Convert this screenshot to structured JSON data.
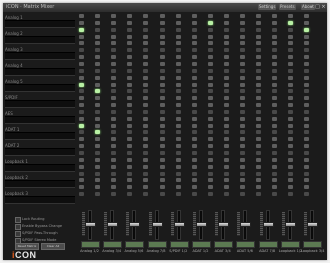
{
  "window": {
    "title": "iCON · Matrix Mixer"
  },
  "titlebar": {
    "buttons": [
      "Settings",
      "Presets",
      "About"
    ]
  },
  "rows": [
    {
      "name": "Analog 1"
    },
    {
      "name": "Analog 2"
    },
    {
      "name": "Analog 3"
    },
    {
      "name": "Analog 4"
    },
    {
      "name": "Analog 5"
    },
    {
      "name": "S/PDIF"
    },
    {
      "name": "AES"
    },
    {
      "name": "ADAT 1"
    },
    {
      "name": "ADAT 2"
    },
    {
      "name": "Loopback 1"
    },
    {
      "name": "Loopback 2"
    },
    {
      "name": "Loopback 3"
    }
  ],
  "matrix": {
    "rows": 27,
    "cols": 15,
    "active": [
      [
        1,
        8
      ],
      [
        1,
        13
      ],
      [
        2,
        0
      ],
      [
        2,
        14
      ],
      [
        10,
        0
      ],
      [
        11,
        1
      ],
      [
        16,
        0
      ],
      [
        17,
        1
      ]
    ]
  },
  "options": [
    {
      "label": "Lock Routing"
    },
    {
      "label": "Enable Bypass Change"
    },
    {
      "label": "S/PDIF Pass-Through"
    },
    {
      "label": "S/PDIF Stereo Mode"
    }
  ],
  "option_buttons": {
    "reset": "Reset Matrix",
    "clear": "Clear All"
  },
  "strips": [
    {
      "label": "Analog 1/2"
    },
    {
      "label": "Analog 3/4"
    },
    {
      "label": "Analog 5/6"
    },
    {
      "label": "Analog 7/8"
    },
    {
      "label": "S/PDIF 1/2"
    },
    {
      "label": "ADAT 1/2"
    },
    {
      "label": "ADAT 3/4"
    },
    {
      "label": "ADAT 5/6"
    },
    {
      "label": "ADAT 7/8"
    },
    {
      "label": "Loopback 1/2"
    },
    {
      "label": "Loopback 3/4"
    }
  ],
  "brand": {
    "name": "iCON",
    "accent": "#e25b1b",
    "active_cell": "#b8f0a4"
  }
}
